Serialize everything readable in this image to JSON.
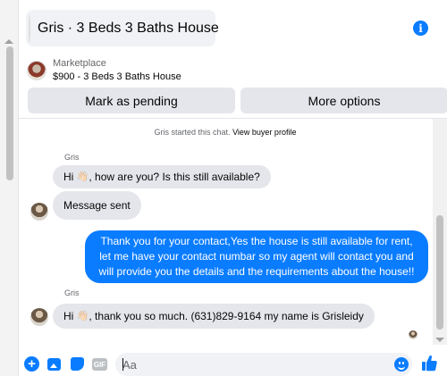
{
  "header": {
    "title": "Gris · 3 Beds 3 Baths House",
    "info_icon": "i"
  },
  "listing": {
    "label": "Marketplace",
    "item": "$900 - 3 Beds 3 Baths House",
    "primary_action": "Mark as pending",
    "secondary_action": "More options"
  },
  "chat": {
    "system": {
      "text": "Gris started this chat.",
      "link": "View buyer profile"
    },
    "messages": [
      {
        "sender": "Gris",
        "direction": "in",
        "prefix": "Hi",
        "emoji": "👋🏻",
        "text": ", how are you? Is this still available?"
      },
      {
        "sender": "",
        "direction": "in",
        "prefix": "",
        "emoji": "",
        "text": "Message sent"
      },
      {
        "sender": "",
        "direction": "out",
        "prefix": "",
        "emoji": "",
        "text": "Thank you for your contact,Yes the house is still available for rent, let me have your contact numbar so my agent will contact you and will provide you the details and the requirements about the house!!"
      },
      {
        "sender": "Gris",
        "direction": "in",
        "prefix": "Hi",
        "emoji": "👋🏻",
        "text": ", thank you so much. (631)829-9164 my name is Grisleidy"
      }
    ]
  },
  "composer": {
    "placeholder": "Aa",
    "gif_label": "GIF"
  },
  "colors": {
    "accent": "#0a7cff",
    "bubble_in": "#e4e6eb",
    "secondary_text": "#65676b"
  }
}
